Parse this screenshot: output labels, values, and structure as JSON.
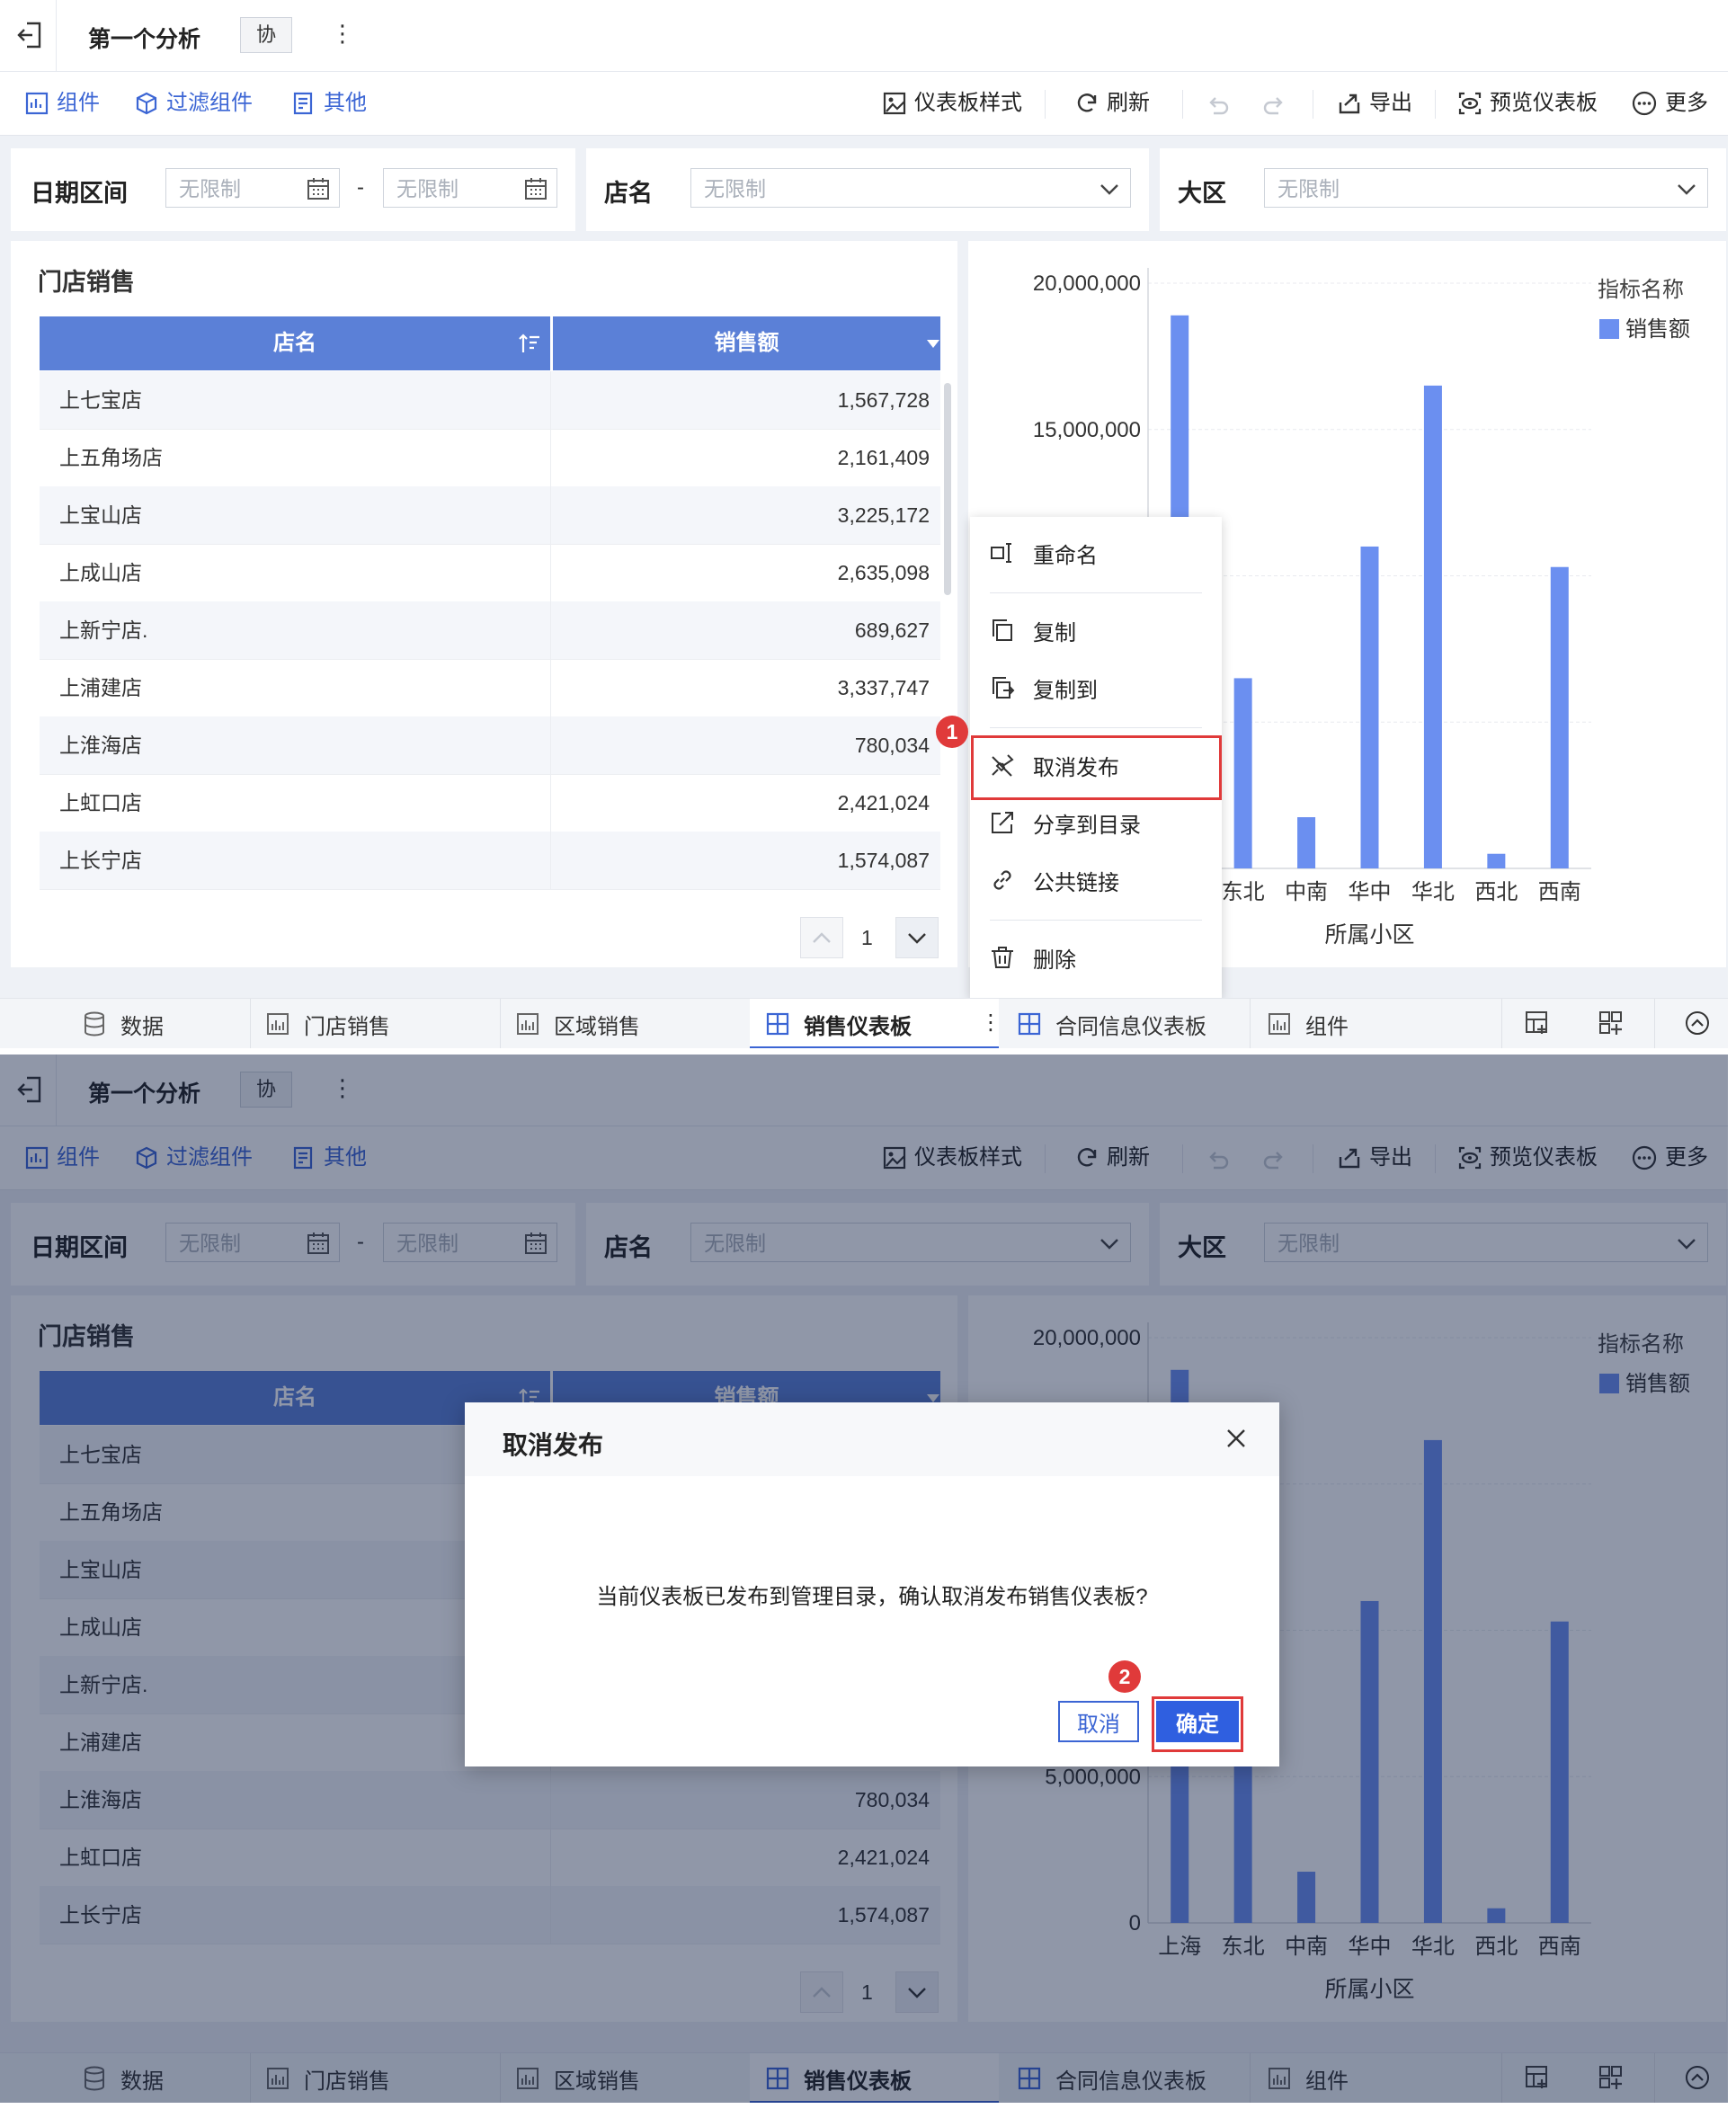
{
  "app": {
    "title": "第一个分析",
    "collab_badge": "协",
    "more_glyph": "⋮"
  },
  "toolbar": {
    "left": [
      {
        "label": "组件",
        "icon": "add-component-icon"
      },
      {
        "label": "过滤组件",
        "icon": "filter-component-icon"
      },
      {
        "label": "其他",
        "icon": "other-icon"
      }
    ],
    "dashboard_style": "仪表板样式",
    "refresh": "刷新",
    "export": "导出",
    "preview": "预览仪表板",
    "more": "更多"
  },
  "filters": {
    "date_label": "日期区间",
    "date_from_placeholder": "无限制",
    "date_to_placeholder": "无限制",
    "date_sep": "-",
    "store_label": "店名",
    "store_value": "无限制",
    "region_label": "大区",
    "region_value": "无限制"
  },
  "table": {
    "title": "门店销售",
    "columns": [
      "店名",
      "销售额"
    ],
    "rows": [
      {
        "name": "上七宝店",
        "value": "1,567,728"
      },
      {
        "name": "上五角场店",
        "value": "2,161,409"
      },
      {
        "name": "上宝山店",
        "value": "3,225,172"
      },
      {
        "name": "上成山店",
        "value": "2,635,098"
      },
      {
        "name": "上新宁店.",
        "value": "689,627"
      },
      {
        "name": "上浦建店",
        "value": "3,337,747"
      },
      {
        "name": "上淮海店",
        "value": "780,034"
      },
      {
        "name": "上虹口店",
        "value": "2,421,024"
      },
      {
        "name": "上长宁店",
        "value": "1,574,087"
      }
    ],
    "page": "1"
  },
  "chart_data": {
    "type": "bar",
    "categories": [
      "上海",
      "东北",
      "中南",
      "华中",
      "华北",
      "西北",
      "西南"
    ],
    "series": [
      {
        "name": "销售额",
        "values": [
          18900000,
          6500000,
          1750000,
          11000000,
          16500000,
          500000,
          10300000
        ],
        "color": "#6b8ff0"
      }
    ],
    "ylim": [
      0,
      20000000
    ],
    "yticks": [
      0,
      5000000,
      10000000,
      15000000,
      20000000
    ],
    "ytick_labels": [
      "0",
      "5,000,000",
      "10,000,000",
      "15,000,000",
      "20,000,000"
    ],
    "xlabel": "所属小区",
    "legend_title": "指标名称",
    "legend_placement": "top-right",
    "grid": true
  },
  "context_menu": {
    "items": [
      "重命名",
      "复制",
      "复制到",
      "取消发布",
      "分享到目录",
      "公共链接",
      "删除"
    ],
    "highlighted": "取消发布",
    "step": "1"
  },
  "tabs": [
    {
      "label": "数据",
      "icon": "database-icon"
    },
    {
      "label": "门店销售",
      "icon": "bar-chart-icon"
    },
    {
      "label": "区域销售",
      "icon": "bar-chart-icon"
    },
    {
      "label": "销售仪表板",
      "icon": "dashboard-icon",
      "active": true
    },
    {
      "label": "合同信息仪表板",
      "icon": "dashboard-icon"
    },
    {
      "label": "组件",
      "icon": "bar-chart-icon"
    }
  ],
  "dialog": {
    "title": "取消发布",
    "message": "当前仪表板已发布到管理目录，确认取消发布销售仪表板?",
    "cancel": "取消",
    "confirm": "确定",
    "step": "2"
  },
  "colors": {
    "accent": "#3b65d4",
    "table_header": "#5b80d7",
    "bar": "#6b8ff0",
    "highlight": "#e03a3a",
    "overlay": "rgba(12,28,66,0.46)"
  }
}
